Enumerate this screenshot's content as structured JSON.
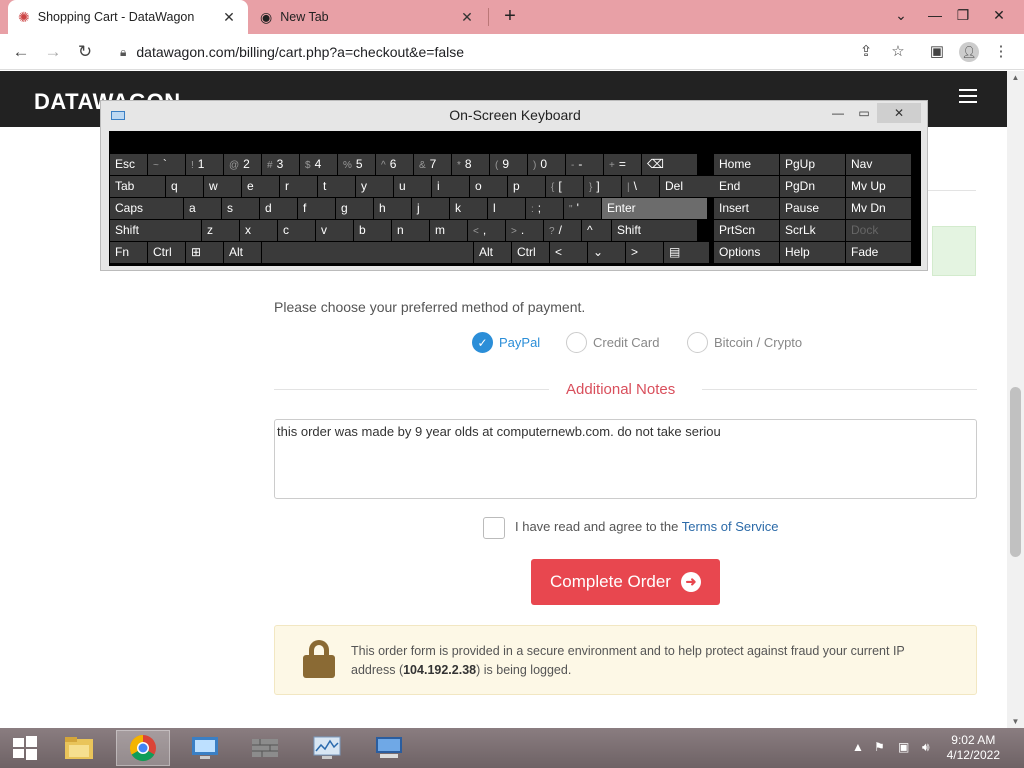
{
  "browser": {
    "tabs": [
      {
        "title": "Shopping Cart - DataWagon",
        "icon": "datawagon-favicon"
      },
      {
        "title": "New Tab",
        "icon": "chrome-favicon"
      }
    ],
    "url": "datawagon.com/billing/cart.php?a=checkout&e=false"
  },
  "site": {
    "logo": "DATAWAGON"
  },
  "payment": {
    "prompt": "Please choose your preferred method of payment.",
    "options": [
      {
        "label": "PayPal",
        "selected": true
      },
      {
        "label": "Credit Card",
        "selected": false
      },
      {
        "label": "Bitcoin / Crypto",
        "selected": false
      }
    ]
  },
  "notes": {
    "title": "Additional Notes",
    "value": "this order was made by 9 year olds at computernewb.com. do not take seriou"
  },
  "tos": {
    "text": "I have read and agree to the ",
    "link": "Terms of Service",
    "checked": false
  },
  "order": {
    "button": "Complete Order"
  },
  "security": {
    "text_before": "This order form is provided in a secure environment and to help protect against fraud your current IP address (",
    "ip": "104.192.2.38",
    "text_after": ") is being logged."
  },
  "osk": {
    "title": "On-Screen Keyboard",
    "rows": [
      [
        [
          "Esc",
          ""
        ],
        [
          "~ `",
          ""
        ],
        [
          "! 1",
          ""
        ],
        [
          "@ 2",
          ""
        ],
        [
          "# 3",
          ""
        ],
        [
          "$ 4",
          ""
        ],
        [
          "% 5",
          ""
        ],
        [
          "^ 6",
          ""
        ],
        [
          "& 7",
          ""
        ],
        [
          "* 8",
          ""
        ],
        [
          "( 9",
          ""
        ],
        [
          ") 0",
          ""
        ],
        [
          "- -",
          ""
        ],
        [
          "+ =",
          ""
        ],
        [
          "⌫",
          ""
        ],
        [
          "Home",
          ""
        ],
        [
          "PgUp",
          ""
        ],
        [
          "Nav",
          ""
        ]
      ],
      [
        [
          "Tab",
          ""
        ],
        [
          "q",
          ""
        ],
        [
          "w",
          ""
        ],
        [
          "e",
          ""
        ],
        [
          "r",
          ""
        ],
        [
          "t",
          ""
        ],
        [
          "y",
          ""
        ],
        [
          "u",
          ""
        ],
        [
          "i",
          ""
        ],
        [
          "o",
          ""
        ],
        [
          "p",
          ""
        ],
        [
          "{ [",
          ""
        ],
        [
          "} ]",
          ""
        ],
        [
          "| \\",
          ""
        ],
        [
          "Del",
          ""
        ],
        [
          "End",
          ""
        ],
        [
          "PgDn",
          ""
        ],
        [
          "Mv Up",
          ""
        ]
      ],
      [
        [
          "Caps",
          ""
        ],
        [
          "a",
          ""
        ],
        [
          "s",
          ""
        ],
        [
          "d",
          ""
        ],
        [
          "f",
          ""
        ],
        [
          "g",
          ""
        ],
        [
          "h",
          ""
        ],
        [
          "j",
          ""
        ],
        [
          "k",
          ""
        ],
        [
          "l",
          ""
        ],
        [
          ": ;",
          ""
        ],
        [
          "\" '",
          ""
        ],
        [
          "Enter",
          ""
        ],
        [
          "Insert",
          ""
        ],
        [
          "Pause",
          ""
        ],
        [
          "Mv Dn",
          ""
        ]
      ],
      [
        [
          "Shift",
          ""
        ],
        [
          "z",
          ""
        ],
        [
          "x",
          ""
        ],
        [
          "c",
          ""
        ],
        [
          "v",
          ""
        ],
        [
          "b",
          ""
        ],
        [
          "n",
          ""
        ],
        [
          "m",
          ""
        ],
        [
          "< ,",
          ""
        ],
        [
          "> .",
          ""
        ],
        [
          "? /",
          ""
        ],
        [
          "^",
          ""
        ],
        [
          "Shift",
          ""
        ],
        [
          "PrtScn",
          ""
        ],
        [
          "ScrLk",
          ""
        ],
        [
          "Dock",
          ""
        ]
      ],
      [
        [
          "Fn",
          ""
        ],
        [
          "Ctrl",
          ""
        ],
        [
          "⊞",
          ""
        ],
        [
          "Alt",
          ""
        ],
        [
          "",
          ""
        ],
        [
          "Alt",
          ""
        ],
        [
          "Ctrl",
          ""
        ],
        [
          "<",
          ""
        ],
        [
          "⌄",
          ""
        ],
        [
          ">",
          ""
        ],
        [
          "▤",
          ""
        ],
        [
          "Options",
          ""
        ],
        [
          "Help",
          ""
        ],
        [
          "Fade",
          ""
        ]
      ]
    ]
  },
  "taskbar": {
    "time": "9:02 AM",
    "date": "4/12/2022",
    "apps": [
      "file-explorer-icon",
      "chrome-icon",
      "control-panel-icon",
      "firewall-icon",
      "performance-monitor-icon",
      "remote-desktop-icon"
    ]
  }
}
